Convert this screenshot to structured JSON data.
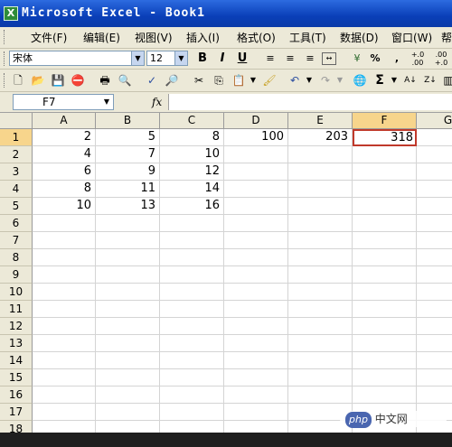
{
  "window": {
    "title": "Microsoft Excel - Book1",
    "icon": "excel-icon"
  },
  "menubar": {
    "items": [
      {
        "label": "文件(F)",
        "id": "file"
      },
      {
        "label": "编辑(E)",
        "id": "edit"
      },
      {
        "label": "视图(V)",
        "id": "view"
      },
      {
        "label": "插入(I)",
        "id": "insert"
      },
      {
        "label": "格式(O)",
        "id": "format"
      },
      {
        "label": "工具(T)",
        "id": "tools"
      },
      {
        "label": "数据(D)",
        "id": "data"
      },
      {
        "label": "窗口(W)",
        "id": "window"
      },
      {
        "label": "帮",
        "id": "help"
      }
    ]
  },
  "format_toolbar": {
    "font": "宋体",
    "font_size": "12",
    "bold": "B",
    "italic": "I",
    "underline": "U",
    "percent": "%",
    "comma": ",",
    "inc_decimal": "+.0 .00",
    "dec_decimal": ".00 +.0"
  },
  "formula_bar": {
    "name_box": "F7",
    "fx": "fx",
    "formula": ""
  },
  "sheet": {
    "columns": [
      "A",
      "B",
      "C",
      "D",
      "E",
      "F",
      "G"
    ],
    "rows": [
      "1",
      "2",
      "3",
      "4",
      "5",
      "6",
      "7",
      "8",
      "9",
      "10",
      "11",
      "12",
      "13",
      "14",
      "15",
      "16",
      "17",
      "18"
    ],
    "active_column": "F",
    "active_row": "1",
    "cells": {
      "A1": "2",
      "B1": "5",
      "C1": "8",
      "D1": "100",
      "E1": "203",
      "F1": "318",
      "A2": "4",
      "B2": "7",
      "C2": "10",
      "A3": "6",
      "B3": "9",
      "C3": "12",
      "A4": "8",
      "B4": "11",
      "C4": "14",
      "A5": "10",
      "B5": "13",
      "C5": "16"
    }
  },
  "watermark": {
    "logo": "php",
    "text": "中文网"
  }
}
